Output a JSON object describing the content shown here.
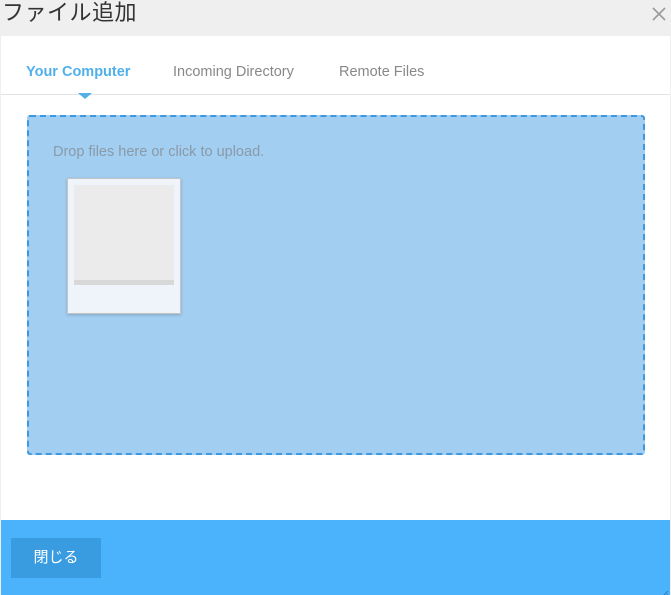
{
  "dialog": {
    "title": "ファイル追加",
    "close_icon": "close-icon"
  },
  "tabs": [
    {
      "label": "Your Computer",
      "active": true
    },
    {
      "label": "Incoming Directory",
      "active": false
    },
    {
      "label": "Remote Files",
      "active": false
    }
  ],
  "dropzone": {
    "hint": "Drop files here or click to upload."
  },
  "footer": {
    "close_label": "閉じる"
  },
  "colors": {
    "accent": "#4fb0ea",
    "dropzone_bg": "#a2cef2",
    "dropzone_border": "#3d98e0",
    "footer_bg": "#4ab3fb",
    "button_bg": "#3a9ce0"
  }
}
